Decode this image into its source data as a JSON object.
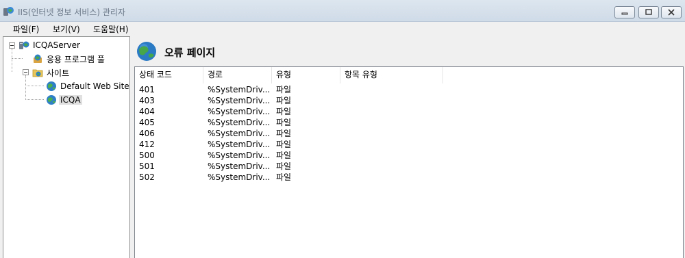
{
  "window": {
    "title": "IIS(인터넷 정보 서비스) 관리자",
    "controls": [
      "minimize-icon",
      "maximize-icon",
      "close-icon"
    ]
  },
  "menu": {
    "items": [
      {
        "label": "파일(F)"
      },
      {
        "label": "보기(V)"
      },
      {
        "label": "도움말(H)"
      }
    ]
  },
  "tree": {
    "server": "ICQAServer",
    "app_pools": "응용 프로그램 풀",
    "sites": "사이트",
    "default_site": "Default Web Site",
    "icqa_site": "ICQA"
  },
  "main": {
    "title": "오류 페이지",
    "columns": [
      "상태 코드",
      "경로",
      "유형",
      "항목 유형"
    ],
    "rows": [
      {
        "code": "401",
        "path": "%SystemDriv...",
        "type": "파일",
        "entry_type": ""
      },
      {
        "code": "403",
        "path": "%SystemDriv...",
        "type": "파일",
        "entry_type": ""
      },
      {
        "code": "404",
        "path": "%SystemDriv...",
        "type": "파일",
        "entry_type": ""
      },
      {
        "code": "405",
        "path": "%SystemDriv...",
        "type": "파일",
        "entry_type": ""
      },
      {
        "code": "406",
        "path": "%SystemDriv...",
        "type": "파일",
        "entry_type": ""
      },
      {
        "code": "412",
        "path": "%SystemDriv...",
        "type": "파일",
        "entry_type": ""
      },
      {
        "code": "500",
        "path": "%SystemDriv...",
        "type": "파일",
        "entry_type": ""
      },
      {
        "code": "501",
        "path": "%SystemDriv...",
        "type": "파일",
        "entry_type": ""
      },
      {
        "code": "502",
        "path": "%SystemDriv...",
        "type": "파일",
        "entry_type": ""
      }
    ]
  },
  "colors": {
    "titlebar": "#cfdbe8",
    "selection": "#e0e0e0",
    "globe": "#2e7fc7"
  }
}
